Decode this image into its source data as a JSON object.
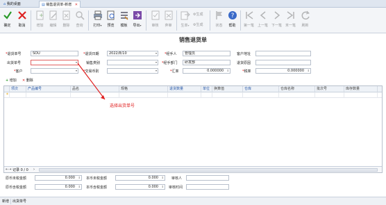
{
  "tabs": [
    {
      "label": "我的桌面",
      "active": false,
      "closable": false
    },
    {
      "label": "销售退货单-新增",
      "active": true,
      "closable": true
    }
  ],
  "toolbar": [
    {
      "id": "confirm",
      "label": "确定",
      "icon": "check-icon",
      "enabled": true
    },
    {
      "id": "cancel",
      "label": "取消",
      "icon": "close-icon",
      "enabled": true
    },
    {
      "id": "add",
      "label": "增加",
      "icon": "document-add-icon",
      "enabled": false
    },
    {
      "id": "edit",
      "label": "编辑",
      "icon": "edit-icon",
      "enabled": false
    },
    {
      "id": "delete",
      "label": "删除",
      "icon": "delete-icon",
      "enabled": false
    },
    {
      "id": "query",
      "label": "查询",
      "icon": "search-icon",
      "enabled": false
    },
    {
      "id": "print",
      "label": "打印",
      "icon": "printer-icon",
      "enabled": true,
      "dropdown": true
    },
    {
      "id": "preview",
      "label": "预览",
      "icon": "preview-icon",
      "enabled": true
    },
    {
      "id": "template",
      "label": "模板",
      "icon": "template-icon",
      "enabled": true
    },
    {
      "id": "export",
      "label": "导出",
      "icon": "export-icon",
      "enabled": true,
      "dropdown": true
    },
    {
      "id": "audit",
      "label": "审核",
      "icon": "audit-icon",
      "enabled": false
    },
    {
      "id": "unaudit",
      "label": "弃审",
      "icon": "unaudit-icon",
      "enabled": false
    },
    {
      "id": "generate",
      "label": "生单",
      "icon": "generate-icon",
      "enabled": false,
      "dropdown": true
    },
    {
      "id": "status",
      "label": "状态",
      "icon": "flag-icon",
      "enabled": false
    },
    {
      "id": "help",
      "label": "帮助",
      "icon": "help-icon",
      "enabled": true
    },
    {
      "id": "first",
      "label": "第一笔",
      "icon": "first-icon",
      "enabled": false
    },
    {
      "id": "prev",
      "label": "上一笔",
      "icon": "prev-icon",
      "enabled": false
    },
    {
      "id": "next",
      "label": "下一笔",
      "icon": "next-icon",
      "enabled": false
    },
    {
      "id": "last",
      "label": "末一笔",
      "icon": "last-icon",
      "enabled": false
    },
    {
      "id": "refresh",
      "label": "刷新",
      "icon": "refresh-icon",
      "enabled": false
    }
  ],
  "toolbar_small": [
    {
      "label": "生成",
      "icon": "gen-small-icon"
    },
    {
      "label": "生成",
      "icon": "gen-small-icon-2"
    }
  ],
  "form": {
    "title": "销售退货单",
    "fields": {
      "return_no": {
        "label": "退货单号",
        "required": true,
        "value": "SOU"
      },
      "return_date": {
        "label": "退货日期",
        "required": true,
        "value": "2022/8/10"
      },
      "handler": {
        "label": "经手人",
        "required": true,
        "value": "管理员"
      },
      "customer_address": {
        "label": "客户地址",
        "required": false,
        "value": ""
      },
      "outbound_no": {
        "label": "出货单号",
        "required": false,
        "value": ""
      },
      "sales_type": {
        "label": "销售类别",
        "required": false,
        "value": ""
      },
      "handler_dept": {
        "label": "经手部门",
        "required": true,
        "value": "研发部"
      },
      "return_reason": {
        "label": "退货原因",
        "required": false,
        "value": ""
      },
      "customer": {
        "label": "客户",
        "required": true,
        "value": ""
      },
      "trade_currency": {
        "label": "交易币别",
        "required": true,
        "value": ""
      },
      "exchange_rate": {
        "label": "汇率",
        "required": true,
        "value": "0.000000"
      },
      "tax_rate": {
        "label": "税率",
        "required": true,
        "value": "0.000000"
      }
    }
  },
  "grid": {
    "add_label": "增加",
    "delete_label": "删除",
    "columns": [
      {
        "label": "项次",
        "highlight": true
      },
      {
        "label": "产品编号",
        "highlight": true
      },
      {
        "label": "品名",
        "highlight": false
      },
      {
        "label": "规格",
        "highlight": false
      },
      {
        "label": "退货数量",
        "highlight": true
      },
      {
        "label": "单位",
        "highlight": true
      },
      {
        "label": "换算值",
        "highlight": false
      },
      {
        "label": "仓库",
        "highlight": true
      },
      {
        "label": "仓库名称",
        "highlight": false
      },
      {
        "label": "批次号",
        "highlight": false
      },
      {
        "label": "库存数量",
        "highlight": false
      }
    ],
    "footer": "记录 0 / 0"
  },
  "annotation": {
    "text": "选择出货单号",
    "color": "#e02020"
  },
  "totals": {
    "orig_untaxed": {
      "label": "原币未税金额",
      "value": "0.000"
    },
    "local_untaxed": {
      "label": "本币未税金额",
      "value": "0.000"
    },
    "reviewer": {
      "label": "审核人",
      "value": ""
    },
    "orig_taxed": {
      "label": "原币含税金额",
      "value": "0.000"
    },
    "local_taxed": {
      "label": "本币含税金额",
      "value": "0.000"
    },
    "review_time": {
      "label": "审核时间",
      "value": ""
    }
  },
  "statusbar": {
    "mode": "新增",
    "field": "出货单号"
  }
}
